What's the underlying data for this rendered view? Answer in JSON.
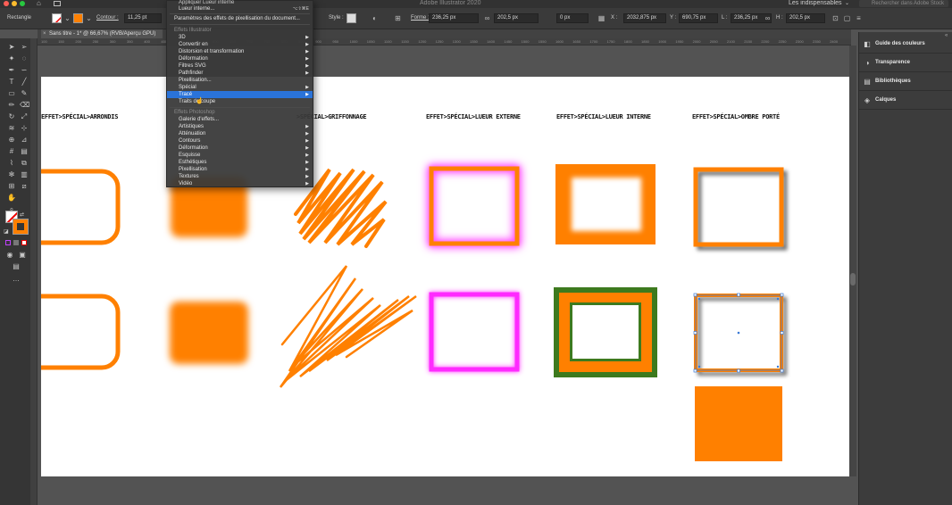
{
  "window": {
    "title": "Adobe Illustrator 2020",
    "workspace": "Les indispensables",
    "search_placeholder": "Rechercher dans Adobe Stock"
  },
  "controlbar": {
    "tool_name": "Rectangle",
    "stroke_label": "Contour :",
    "stroke_value": "11,25 pt",
    "style_label": "Style :",
    "shape_label": "Forme :",
    "w_field": "236,25 px",
    "h_field": "202,5 px",
    "angle": "0 px",
    "x_label": "X :",
    "x_value": "2032,875 px",
    "y_label": "Y :",
    "y_value": "690,75 px",
    "l_label": "L :",
    "l_value": "236,25 px",
    "h2_label": "H :",
    "h2_value": "202,5 px",
    "fill_color": "#ff8000"
  },
  "document_tab": "Sans titre - 1* @ 66,67% (RVB/Aperçu GPU)",
  "ruler_ticks": [
    "100",
    "150",
    "200",
    "250",
    "300",
    "350",
    "400",
    "450",
    "500",
    "550",
    "600",
    "650",
    "700",
    "750",
    "800",
    "850",
    "900",
    "950",
    "1000",
    "1050",
    "1100",
    "1150",
    "1200",
    "1250",
    "1300",
    "1350",
    "1400",
    "1450",
    "1500",
    "1550",
    "1600",
    "1650",
    "1700",
    "1750",
    "1800",
    "1850",
    "1900",
    "1950",
    "2000",
    "2050",
    "2100",
    "2150",
    "2200",
    "2250",
    "2300",
    "2350",
    "2400"
  ],
  "menu": {
    "top_items": [
      {
        "label": "Appliquer Lueur interne",
        "shortcut": ""
      },
      {
        "label": "Lueur interne...",
        "shortcut": "⌥⇧⌘E"
      }
    ],
    "doc_settings": "Paramètres des effets de pixellisation du document...",
    "illustrator_header": "Effets Illustrator",
    "illustrator_items": [
      {
        "label": "3D",
        "submenu": true
      },
      {
        "label": "Convertir en",
        "submenu": true
      },
      {
        "label": "Distorsion et transformation",
        "submenu": true
      },
      {
        "label": "Déformation",
        "submenu": true
      },
      {
        "label": "Filtres SVG",
        "submenu": true
      },
      {
        "label": "Pathfinder",
        "submenu": true
      },
      {
        "label": "Pixellisation...",
        "submenu": false
      },
      {
        "label": "Spécial",
        "submenu": true
      },
      {
        "label": "Tracé",
        "submenu": true
      },
      {
        "label": "Traits de coupe",
        "submenu": false
      }
    ],
    "highlighted_item": "Tracé",
    "photoshop_header": "Effets Photoshop",
    "photoshop_items": [
      {
        "label": "Galerie d'effets...",
        "submenu": false
      },
      {
        "label": "Artistiques",
        "submenu": true
      },
      {
        "label": "Atténuation",
        "submenu": true
      },
      {
        "label": "Contours",
        "submenu": true
      },
      {
        "label": "Déformation",
        "submenu": true
      },
      {
        "label": "Esquisse",
        "submenu": true
      },
      {
        "label": "Esthétiques",
        "submenu": true
      },
      {
        "label": "Pixellisation",
        "submenu": true
      },
      {
        "label": "Textures",
        "submenu": true
      },
      {
        "label": "Vidéo",
        "submenu": true
      }
    ]
  },
  "canvas_labels": [
    "EFFET>SPÉCIAL>ARRONDIS",
    ">SPÉCIAL>GRIFFONNAGE",
    "EFFET>SPÉCIAL>LUEUR EXTERNE",
    "EFFET>SPÉCIAL>LUEUR INTERNE",
    "EFFET>SPÉCIAL>OMBRE PORTÉ"
  ],
  "colors": {
    "orange": "#ff8000",
    "magenta": "#ff2bff",
    "green": "#3d7a1e",
    "selection": "#3a79d6"
  },
  "panels": [
    {
      "label": "Guide des couleurs",
      "icon": "color-guide-icon"
    },
    {
      "label": "Transparence",
      "icon": "transparency-icon"
    },
    {
      "label": "Bibliothèques",
      "icon": "libraries-icon"
    },
    {
      "label": "Calques",
      "icon": "layers-icon"
    }
  ]
}
